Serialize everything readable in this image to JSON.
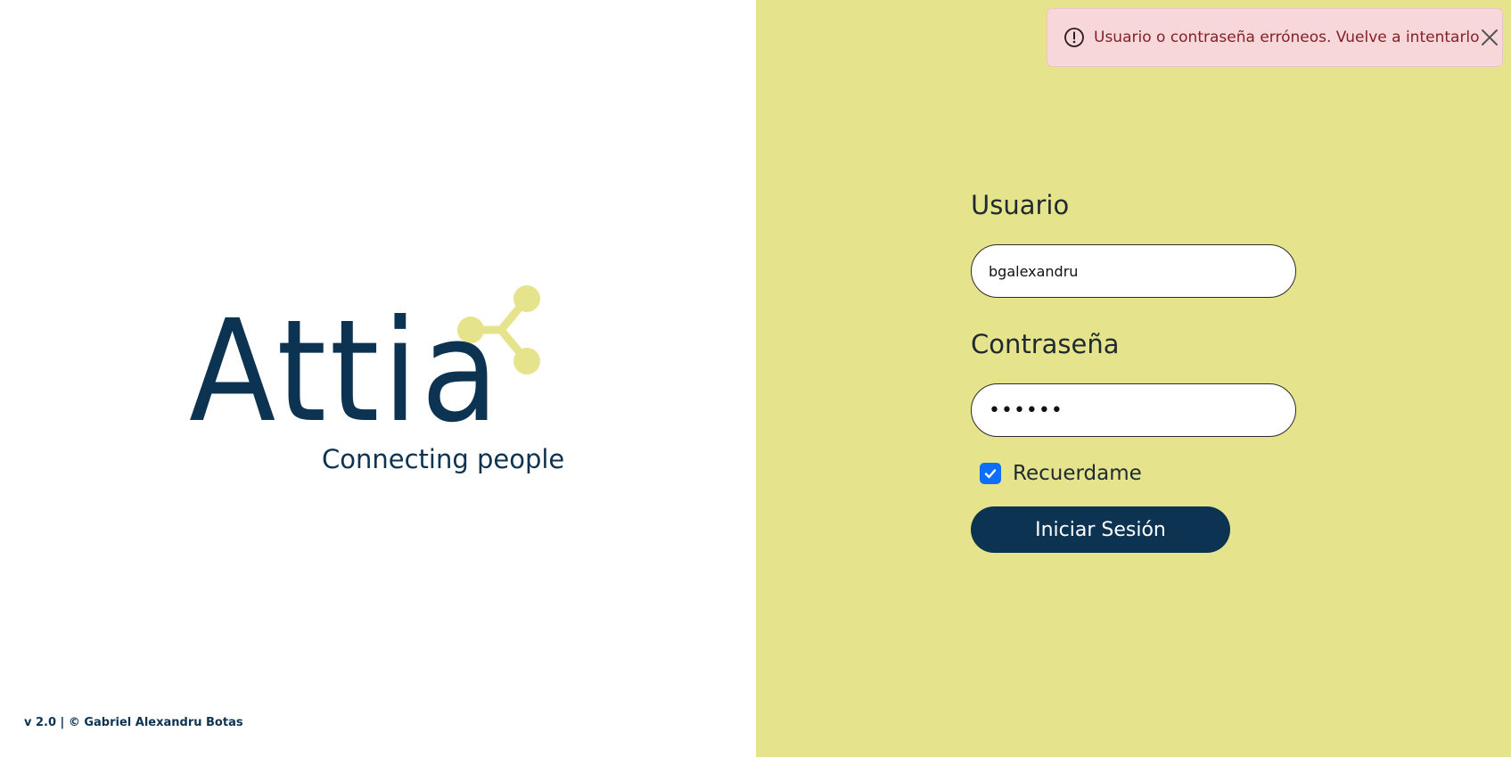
{
  "brand": {
    "name": "Attia",
    "tagline": "Connecting people",
    "primary_color": "#0d3352",
    "accent_color": "#e5e48c",
    "logo_icon": "share-nodes-icon"
  },
  "footer": {
    "text": "v 2.0 | © Gabriel Alexandru Botas"
  },
  "alert": {
    "message": "Usuario o contraseña erróneos. Vuelve a intentarlo",
    "icon": "exclamation-circle-icon",
    "close_icon": "close-icon",
    "bg_color": "#f8d7da",
    "text_color": "#842029"
  },
  "login": {
    "username_label": "Usuario",
    "username_value": "bgalexandru",
    "password_label": "Contraseña",
    "password_value": "••••••",
    "remember_label": "Recuerdame",
    "remember_checked": true,
    "submit_label": "Iniciar Sesión"
  }
}
